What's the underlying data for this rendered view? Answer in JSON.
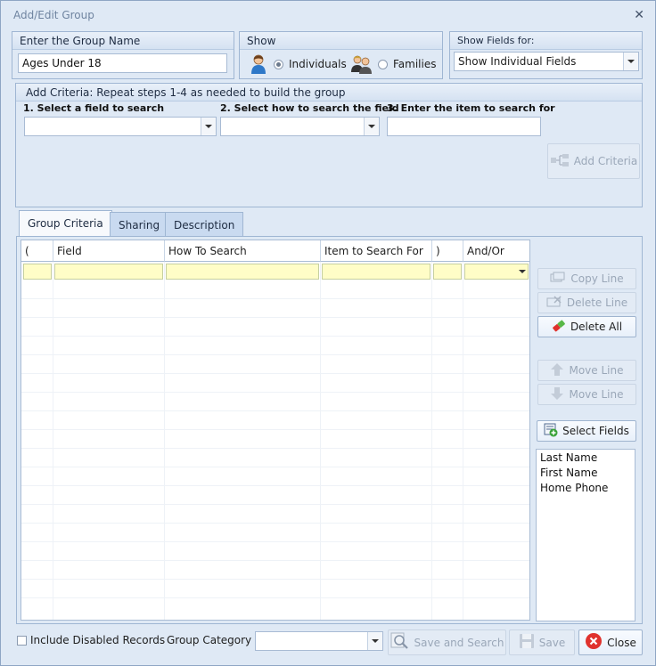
{
  "window": {
    "title": "Add/Edit Group"
  },
  "group_name": {
    "header": "Enter the Group Name",
    "value": "Ages Under 18"
  },
  "show": {
    "header": "Show",
    "options": [
      {
        "label": "Individuals",
        "selected": true
      },
      {
        "label": "Families",
        "selected": false
      }
    ]
  },
  "show_fields": {
    "header": "Show Fields for:",
    "value": "Show Individual Fields"
  },
  "criteria": {
    "header": "Add Criteria: Repeat steps 1-4 as needed to build the group",
    "step1": "1. Select a field to search",
    "step2": "2. Select how to search the field",
    "step3": "3. Enter the item to search for",
    "add_button": "Add Criteria"
  },
  "tabs": [
    {
      "label": "Group Criteria",
      "selected": true
    },
    {
      "label": "Sharing",
      "selected": false
    },
    {
      "label": "Description",
      "selected": false
    }
  ],
  "grid": {
    "columns": [
      "(",
      "Field",
      "How To Search",
      "Item to Search For",
      ")",
      "And/Or"
    ]
  },
  "side_buttons": {
    "copy_line": "Copy Line",
    "delete_line": "Delete Line",
    "delete_all": "Delete All",
    "move_up": "Move Line",
    "move_down": "Move Line",
    "select_fields": "Select Fields"
  },
  "selected_fields": [
    "Last Name",
    "First Name",
    "Home Phone"
  ],
  "footer": {
    "include_disabled": "Include Disabled Records",
    "include_disabled_checked": false,
    "group_category_label": "Group Category",
    "group_category_value": "",
    "save_and_search": "Save and Search",
    "save": "Save",
    "close": "Close"
  },
  "colors": {
    "accent": "#dfe9f5",
    "grid_cell": "#fffdc7",
    "close_icon": "#e0322d"
  }
}
